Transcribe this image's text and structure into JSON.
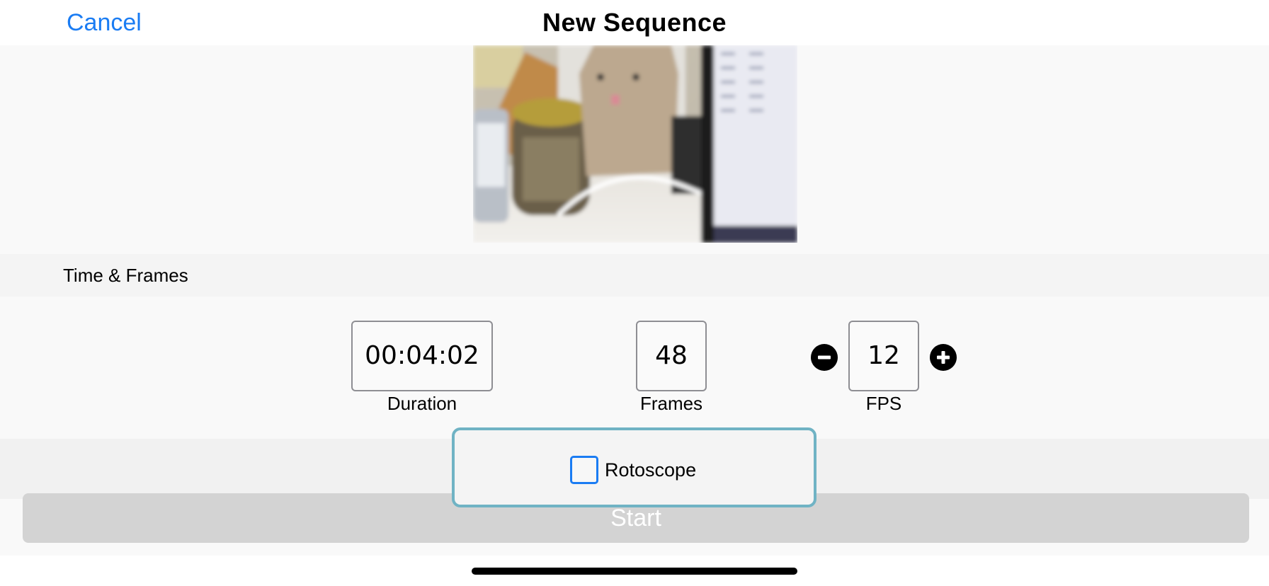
{
  "nav": {
    "cancel_label": "Cancel",
    "title": "New Sequence"
  },
  "section": {
    "title": "Time & Frames"
  },
  "controls": {
    "duration_value": "00:04:02",
    "duration_label": "Duration",
    "frames_value": "48",
    "frames_label": "Frames",
    "fps_value": "12",
    "fps_label": "FPS"
  },
  "rotoscope": {
    "label": "Rotoscope",
    "checked": false
  },
  "start": {
    "label": "Start"
  },
  "colors": {
    "accent": "#1a7cf3",
    "highlight_border": "#70b3c4",
    "start_disabled": "#d3d3d3"
  },
  "icons": {
    "decrement": "minus-circle-icon",
    "increment": "plus-circle-icon"
  }
}
